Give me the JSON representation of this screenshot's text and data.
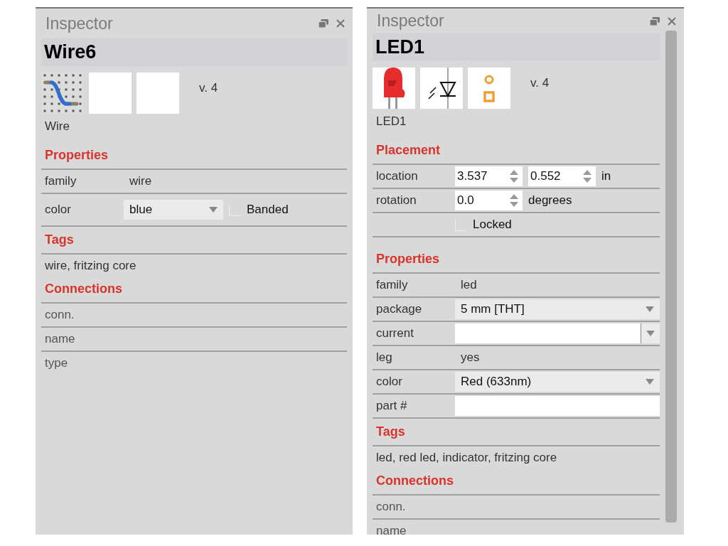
{
  "panels": [
    {
      "title": "Inspector",
      "part_name": "Wire6",
      "scrollable": false,
      "images": [
        {
          "kind": "wire"
        },
        {
          "kind": "blank"
        },
        {
          "kind": "blank"
        }
      ],
      "version": "v. 4",
      "part_label": "Wire",
      "sections": [
        {
          "kind": "rows",
          "title": "Properties",
          "rows": [
            {
              "kind": "text",
              "label": "family",
              "value": "wire"
            },
            {
              "kind": "dropdown",
              "label": "color",
              "value": "blue",
              "checkbox": {
                "label": "Banded",
                "checked": false
              }
            }
          ]
        },
        {
          "kind": "tags",
          "title": "Tags",
          "text": "wire, fritzing core"
        },
        {
          "kind": "connections",
          "title": "Connections",
          "items": [
            "conn.",
            "name",
            "type"
          ]
        }
      ]
    },
    {
      "title": "Inspector",
      "part_name": "LED1",
      "scrollable": true,
      "images": [
        {
          "kind": "led"
        },
        {
          "kind": "schematic"
        },
        {
          "kind": "pcb"
        }
      ],
      "version": "v. 4",
      "part_label": "LED1",
      "sections": [
        {
          "kind": "rows",
          "title": "Placement",
          "rows": [
            {
              "kind": "spin",
              "label": "location",
              "values": [
                "3.537",
                "0.552"
              ],
              "unit": "in"
            },
            {
              "kind": "spin",
              "label": "rotation",
              "values": [
                "0.0"
              ],
              "unit": "degrees"
            },
            {
              "kind": "check",
              "checkbox": {
                "label": "Locked",
                "checked": false
              }
            }
          ]
        },
        {
          "kind": "rows",
          "title": "Properties",
          "rows": [
            {
              "kind": "text",
              "label": "family",
              "value": "led"
            },
            {
              "kind": "dropdown",
              "label": "package",
              "value": "5 mm [THT]"
            },
            {
              "kind": "combo",
              "label": "current"
            },
            {
              "kind": "text",
              "label": "leg",
              "value": "yes"
            },
            {
              "kind": "dropdown",
              "label": "color",
              "value": "Red (633nm)"
            },
            {
              "kind": "field",
              "label": "part #"
            }
          ]
        },
        {
          "kind": "tags",
          "title": "Tags",
          "text": "led, red led, indicator, fritzing core"
        },
        {
          "kind": "connections",
          "title": "Connections",
          "items": [
            "conn.",
            "name"
          ]
        }
      ]
    }
  ]
}
